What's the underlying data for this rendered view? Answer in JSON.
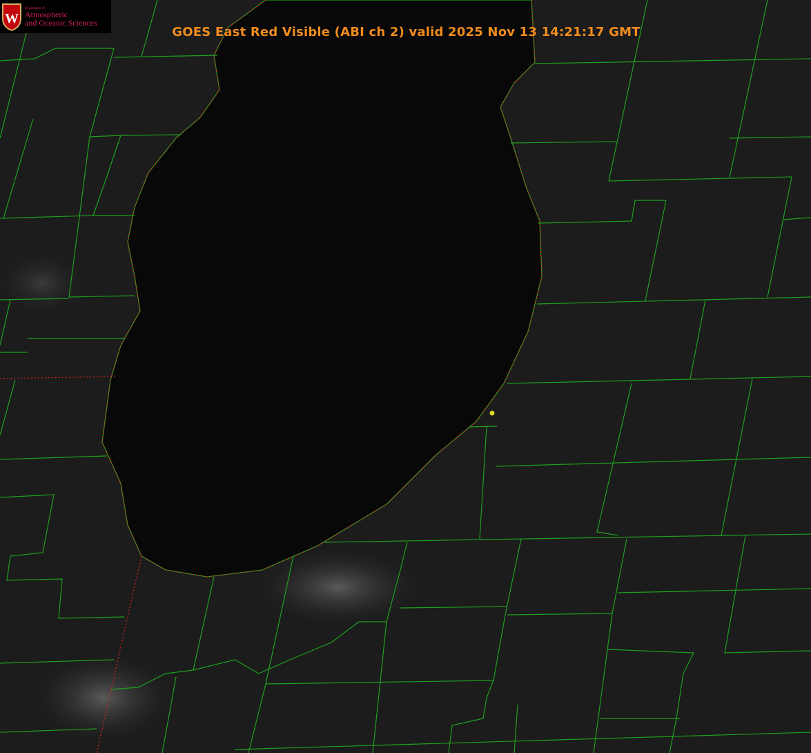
{
  "title": "GOES East Red Visible (ABI ch 2) valid 2025 Nov 13 14:21:17 GMT",
  "logo": {
    "line1": "Department of",
    "line2": "Atmospheric",
    "line3": "and Oceanic Sciences",
    "crest_letter": "W"
  },
  "colors": {
    "title": "#f08c1e",
    "county_lines": "#1fa01f",
    "coastline": "#e02020",
    "marker": "#d8d820",
    "logo_text": "#d2205a"
  }
}
